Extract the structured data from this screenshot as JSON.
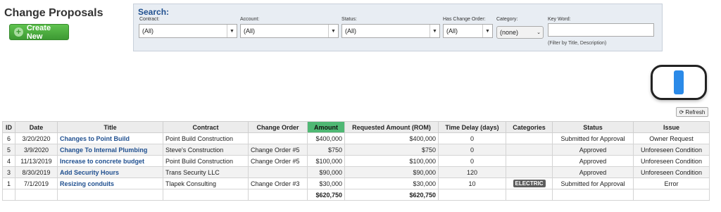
{
  "page_title": "Change Proposals",
  "create_button": "Create New",
  "search": {
    "title": "Search:",
    "contract_label": "Contract:",
    "contract_value": "(All)",
    "account_label": "Account:",
    "account_value": "(All)",
    "status_label": "Status:",
    "status_value": "(All)",
    "has_co_label": "Has Change Order:",
    "has_co_value": "(All)",
    "category_label": "Category:",
    "category_value": "(none)",
    "keyword_label": "Key Word:",
    "keyword_value": "",
    "keyword_hint": "(Filter by Title, Description)"
  },
  "refresh_label": "Refresh",
  "table": {
    "headers": [
      "ID",
      "Date",
      "Title",
      "Contract",
      "Change Order",
      "Amount",
      "Requested Amount (ROM)",
      "Time Delay (days)",
      "Categories",
      "Status",
      "Issue"
    ],
    "rows": [
      {
        "id": "6",
        "date": "3/20/2020",
        "title": "Changes to Point Build",
        "contract": "Point Build Construction",
        "change_order": "",
        "amount": "$400,000",
        "requested": "$400,000",
        "delay": "0",
        "category": "",
        "status": "Submitted for Approval",
        "issue": "Owner Request"
      },
      {
        "id": "5",
        "date": "3/9/2020",
        "title": "Change To Internal Plumbing",
        "contract": "Steve's Construction",
        "change_order": "Change Order #5",
        "amount": "$750",
        "requested": "$750",
        "delay": "0",
        "category": "",
        "status": "Approved",
        "issue": "Unforeseen Condition"
      },
      {
        "id": "4",
        "date": "11/13/2019",
        "title": "Increase to concrete budget",
        "contract": "Point Build Construction",
        "change_order": "Change Order #5",
        "amount": "$100,000",
        "requested": "$100,000",
        "delay": "0",
        "category": "",
        "status": "Approved",
        "issue": "Unforeseen Condition"
      },
      {
        "id": "3",
        "date": "8/30/2019",
        "title": "Add Security Hours",
        "contract": "Trans Security LLC",
        "change_order": "",
        "amount": "$90,000",
        "requested": "$90,000",
        "delay": "120",
        "category": "",
        "status": "Approved",
        "issue": "Unforeseen Condition"
      },
      {
        "id": "1",
        "date": "7/1/2019",
        "title": "Resizing conduits",
        "contract": "Tlapek Consulting",
        "change_order": "Change Order #3",
        "amount": "$30,000",
        "requested": "$30,000",
        "delay": "10",
        "category": "ELECTRIC",
        "status": "Submitted for Approval",
        "issue": "Error"
      }
    ],
    "totals": {
      "amount": "$620,750",
      "requested": "$620,750"
    }
  },
  "icons": {
    "create": "plus-circle-icon",
    "refresh": "refresh-icon",
    "device": "phone-icon"
  },
  "colors": {
    "create_button": "#3d9a33",
    "amount_header": "#4fb874",
    "link": "#1f4f8f"
  }
}
